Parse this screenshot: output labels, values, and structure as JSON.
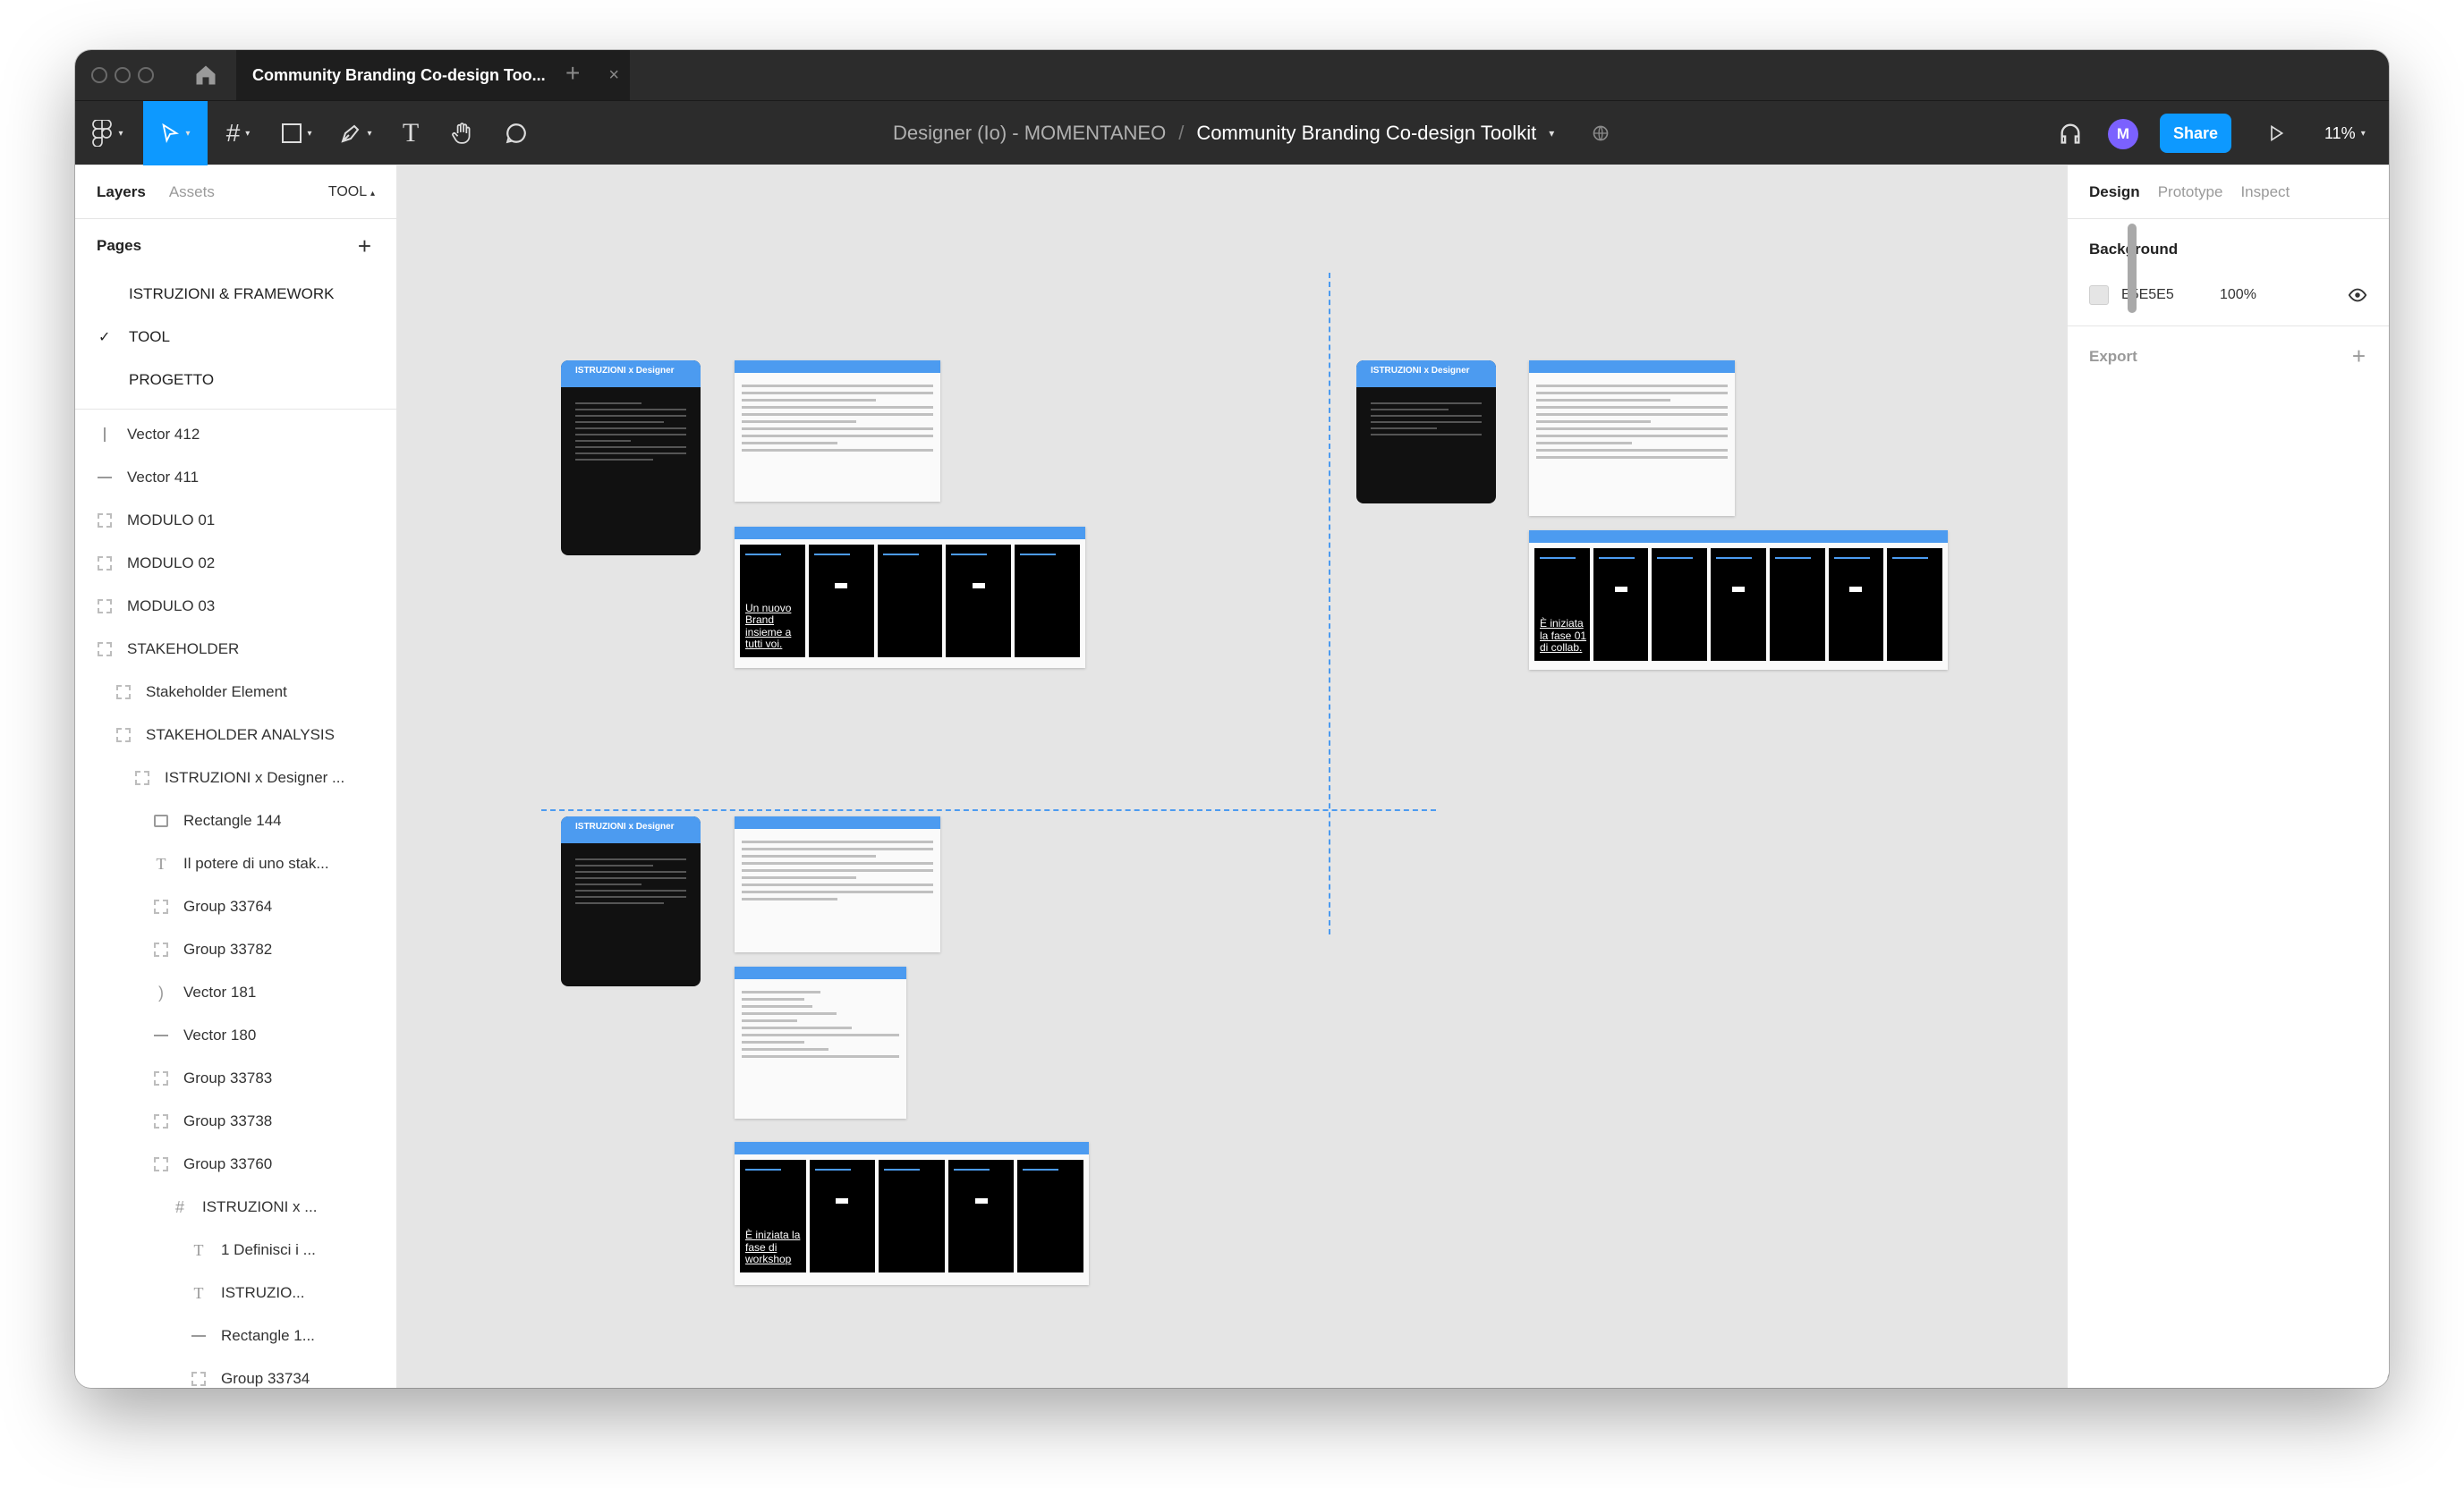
{
  "tab": {
    "title": "Community Branding Co-design Too...",
    "close": "×",
    "new": "+"
  },
  "breadcrumb": {
    "team": "Designer (Io) - MOMENTANEO",
    "sep": "/",
    "file": "Community Branding Co-design Toolkit"
  },
  "toolbar": {
    "share_label": "Share",
    "avatar_letter": "M",
    "zoom": "11%"
  },
  "left_panel": {
    "tabs": {
      "layers": "Layers",
      "assets": "Assets",
      "page": "TOOL"
    },
    "pages_title": "Pages",
    "pages": [
      "ISTRUZIONI & FRAMEWORK",
      "TOOL",
      "PROGETTO"
    ],
    "layers": [
      {
        "name": "Vector 412",
        "icon": "vector-line-icon",
        "indent": 0
      },
      {
        "name": "Vector 411",
        "icon": "line-icon",
        "indent": 0
      },
      {
        "name": "MODULO 01",
        "icon": "frame-icon",
        "indent": 0
      },
      {
        "name": "MODULO 02",
        "icon": "frame-icon",
        "indent": 0
      },
      {
        "name": "MODULO 03",
        "icon": "frame-icon",
        "indent": 0
      },
      {
        "name": "STAKEHOLDER",
        "icon": "frame-icon",
        "indent": 0
      },
      {
        "name": "Stakeholder Element",
        "icon": "frame-icon",
        "indent": 1
      },
      {
        "name": "STAKEHOLDER ANALYSIS",
        "icon": "frame-icon",
        "indent": 1
      },
      {
        "name": "ISTRUZIONI x Designer ...",
        "icon": "frame-icon",
        "indent": 2
      },
      {
        "name": "Rectangle 144",
        "icon": "rectangle-icon",
        "indent": 3
      },
      {
        "name": "Il potere di uno stak...",
        "icon": "text-icon",
        "indent": 3
      },
      {
        "name": "Group 33764",
        "icon": "frame-icon",
        "indent": 3
      },
      {
        "name": "Group 33782",
        "icon": "frame-icon",
        "indent": 3
      },
      {
        "name": "Vector 181",
        "icon": "curve-icon",
        "indent": 3
      },
      {
        "name": "Vector 180",
        "icon": "line-icon",
        "indent": 3
      },
      {
        "name": "Group 33783",
        "icon": "frame-icon",
        "indent": 3
      },
      {
        "name": "Group 33738",
        "icon": "frame-icon",
        "indent": 3
      },
      {
        "name": "Group 33760",
        "icon": "frame-icon",
        "indent": 3
      },
      {
        "name": "ISTRUZIONI x ...",
        "icon": "hash-frame-icon",
        "indent": 4
      },
      {
        "name": "1 Definisci i ...",
        "icon": "text-icon",
        "indent": 5
      },
      {
        "name": "ISTRUZIO...",
        "icon": "text-icon",
        "indent": 5
      },
      {
        "name": "Rectangle 1...",
        "icon": "line-icon",
        "indent": 5
      },
      {
        "name": "Group 33734",
        "icon": "frame-icon",
        "indent": 5
      }
    ]
  },
  "right_panel": {
    "tabs": {
      "design": "Design",
      "prototype": "Prototype",
      "inspect": "Inspect"
    },
    "background_title": "Background",
    "background_hex": "E5E5E5",
    "background_opacity": "100%",
    "export_title": "Export"
  },
  "canvas": {
    "card_title": "ISTRUZIONI x Designer",
    "strip1": [
      "Un nuovo Brand insieme a tutti voi.",
      "",
      "",
      "",
      ""
    ],
    "strip2": [
      "È iniziata la fase 01 di collab.",
      "",
      "",
      "",
      "",
      "",
      ""
    ],
    "strip3": [
      "È iniziata la fase di workshop",
      "",
      "",
      "",
      ""
    ]
  },
  "help": "?",
  "colors": {
    "accent": "#0d99ff",
    "canvas": "#e5e5e5",
    "frame_header": "#4c9bf0",
    "avatar": "#7b61ff"
  }
}
